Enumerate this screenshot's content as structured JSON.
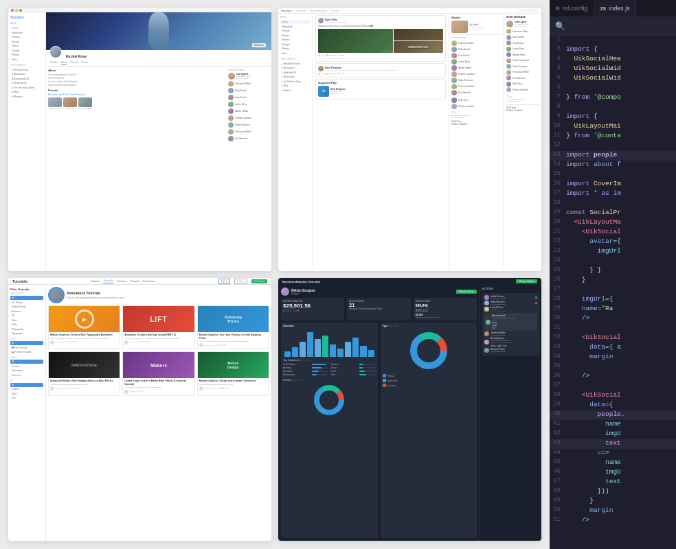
{
  "editor": {
    "tabs": [
      {
        "name": "nd.config",
        "lang": "config",
        "active": false
      },
      {
        "name": "index.js",
        "lang": "js",
        "active": true
      }
    ],
    "lines": [
      {
        "num": 1,
        "content": ""
      },
      {
        "num": 2,
        "content": "import {"
      },
      {
        "num": 3,
        "content": "  UikSocialHea"
      },
      {
        "num": 4,
        "content": "  UikSocialWid"
      },
      {
        "num": 5,
        "content": "  UikSocialWid"
      },
      {
        "num": 6,
        "content": ""
      },
      {
        "num": 7,
        "content": "} from '@compo"
      },
      {
        "num": 8,
        "content": ""
      },
      {
        "num": 9,
        "content": "import {"
      },
      {
        "num": 10,
        "content": "  UikLayoutMai"
      },
      {
        "num": 11,
        "content": "} from '@conta"
      },
      {
        "num": 12,
        "content": ""
      },
      {
        "num": 13,
        "content": "import people"
      },
      {
        "num": 14,
        "content": "import about f"
      },
      {
        "num": 15,
        "content": ""
      },
      {
        "num": 16,
        "content": "import CoverIm"
      },
      {
        "num": 17,
        "content": "import * as im"
      },
      {
        "num": 18,
        "content": ""
      },
      {
        "num": 19,
        "content": "const SocialPr"
      },
      {
        "num": 20,
        "content": "  <UikLayoutMa"
      },
      {
        "num": 21,
        "content": "    <UikSocial"
      },
      {
        "num": 22,
        "content": "      avatar={"
      },
      {
        "num": 23,
        "content": "        imgUrl"
      },
      {
        "num": 24,
        "content": ""
      },
      {
        "num": 25,
        "content": "      } }"
      },
      {
        "num": 26,
        "content": "    }"
      },
      {
        "num": 27,
        "content": ""
      },
      {
        "num": 28,
        "content": "    imgUrl={"
      },
      {
        "num": 29,
        "content": "    name=\"Ra"
      },
      {
        "num": 30,
        "content": "    />"
      },
      {
        "num": 31,
        "content": ""
      },
      {
        "num": 32,
        "content": "    <UikSocial"
      },
      {
        "num": 33,
        "content": "      data={ a"
      },
      {
        "num": 34,
        "content": "      margin"
      },
      {
        "num": 35,
        "content": ""
      },
      {
        "num": 36,
        "content": "    />"
      },
      {
        "num": 37,
        "content": ""
      },
      {
        "num": 38,
        "content": "    <UikSocial"
      },
      {
        "num": 39,
        "content": "      data={"
      },
      {
        "num": 40,
        "content": "        people"
      },
      {
        "num": 41,
        "content": "          name"
      },
      {
        "num": 42,
        "content": "          imgU"
      },
      {
        "num": 43,
        "content": "          text"
      },
      {
        "num": 44,
        "content": "        ==>"
      },
      {
        "num": 45,
        "content": "          name"
      },
      {
        "num": 46,
        "content": "          imgU"
      },
      {
        "num": 47,
        "content": "          text"
      },
      {
        "num": 48,
        "content": "        }))"
      },
      {
        "num": 49,
        "content": "      }"
      },
      {
        "num": 50,
        "content": "      margin"
      },
      {
        "num": 51,
        "content": "    />"
      }
    ]
  },
  "ui": {
    "social_profile": {
      "logo": "Sociatio",
      "nav_items": [
        "Home",
        "Newsfeed",
        "Friends",
        "Events",
        "Videos",
        "Groups",
        "Photos",
        "Files"
      ],
      "user_name": "Rachel Rose",
      "tabs": [
        "Timeline",
        "About",
        "Friends",
        "Photos"
      ],
      "active_tab": "About"
    },
    "social_feed": {
      "logo": "Sociatio",
      "nav_items": [
        "Home",
        "Newsfeed",
        "Friends",
        "Events",
        "Videos",
        "Groups",
        "Photos",
        "Files"
      ],
      "stories_title": "Stories",
      "suggested_page": "Suggested Page"
    },
    "tutorial": {
      "logo": "Tutorialio",
      "nav_items": [
        "Explore",
        "Tutorials",
        "Courses",
        "Projects",
        "Resources"
      ],
      "page_title": "Animations Tutorials",
      "filter_title": "Filter Tutorials",
      "categories": [
        "All",
        "Tutorials",
        "Free Tutorials",
        "Premium Tutorials"
      ],
      "cards": [
        {
          "title": "Motion Graphics: Create a Nice Typography Animation",
          "thumb_class": "ts-thumb-1"
        },
        {
          "title": "Animation: Create a flat logo reveal (PART 2)",
          "thumb_class": "ts-thumb-2"
        },
        {
          "title": "Motion Graphics: Give Your Vectors Life with Amazing Tricks",
          "thumb_class": "ts-thumb-3"
        },
        {
          "title": "Advanced Motion: Raw footage edition on After Effects",
          "thumb_class": "ts-thumb-4"
        },
        {
          "title": "Create a logo reveal in Adobe After Effects (Christmas Special)",
          "thumb_class": "ts-thumb-5"
        },
        {
          "title": "Motion Graphics: Design and Animate Transitions",
          "thumb_class": "ts-thumb-6"
        }
      ]
    },
    "analytics": {
      "title": "Business Analytics Overview",
      "user_name": "Nikita Douglas",
      "balance": "$25,901.56",
      "active_users": "21",
      "revenue_total": "$46,119",
      "revenue_change": "-12.0M",
      "sessions": "969,942",
      "bounce": "428,112",
      "type_title": "Type",
      "countries_title": "Top Countries",
      "countries": [
        {
          "name": "United States",
          "pct": 85
        },
        {
          "name": "Australia",
          "pct": 60
        },
        {
          "name": "Zimbabwe",
          "pct": 45
        },
        {
          "name": "Mozambique",
          "pct": 30
        },
        {
          "name": "Jamaica",
          "pct": 25
        },
        {
          "name": "Ghana",
          "pct": 20
        },
        {
          "name": "China",
          "pct": 35
        },
        {
          "name": "India",
          "pct": 40
        }
      ],
      "bars": [
        8,
        14,
        20,
        35,
        25,
        30,
        18,
        12,
        22,
        28,
        15,
        10
      ]
    }
  },
  "colors": {
    "editor_bg": "#1e1e2e",
    "editor_line_bg": "#181825",
    "accent_blue": "#4a90e2",
    "accent_green": "#27ae60"
  }
}
